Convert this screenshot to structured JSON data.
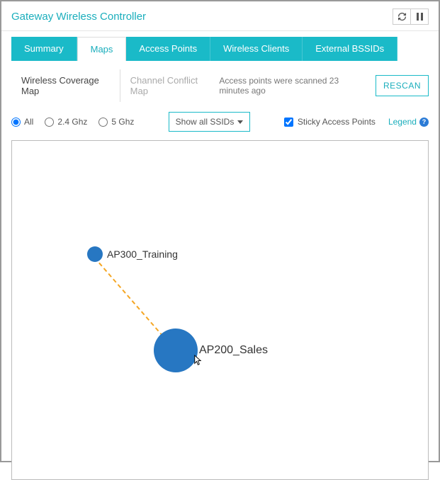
{
  "header": {
    "title": "Gateway Wireless Controller"
  },
  "tabs": {
    "summary": "Summary",
    "maps": "Maps",
    "access_points": "Access Points",
    "wireless_clients": "Wireless Clients",
    "external_bssids": "External BSSIDs"
  },
  "subtabs": {
    "coverage": "Wireless Coverage Map",
    "conflict": "Channel Conflict Map"
  },
  "status": {
    "scan_msg": "Access points were scanned 23 minutes ago",
    "rescan_label": "RESCAN"
  },
  "filters": {
    "all": "All",
    "ghz24": "2.4 Ghz",
    "ghz5": "5 Ghz",
    "ssid_select": "Show all SSIDs",
    "sticky_label": "Sticky Access Points",
    "legend": "Legend"
  },
  "map": {
    "ap_training": "AP300_Training",
    "ap_sales": "AP200_Sales"
  }
}
